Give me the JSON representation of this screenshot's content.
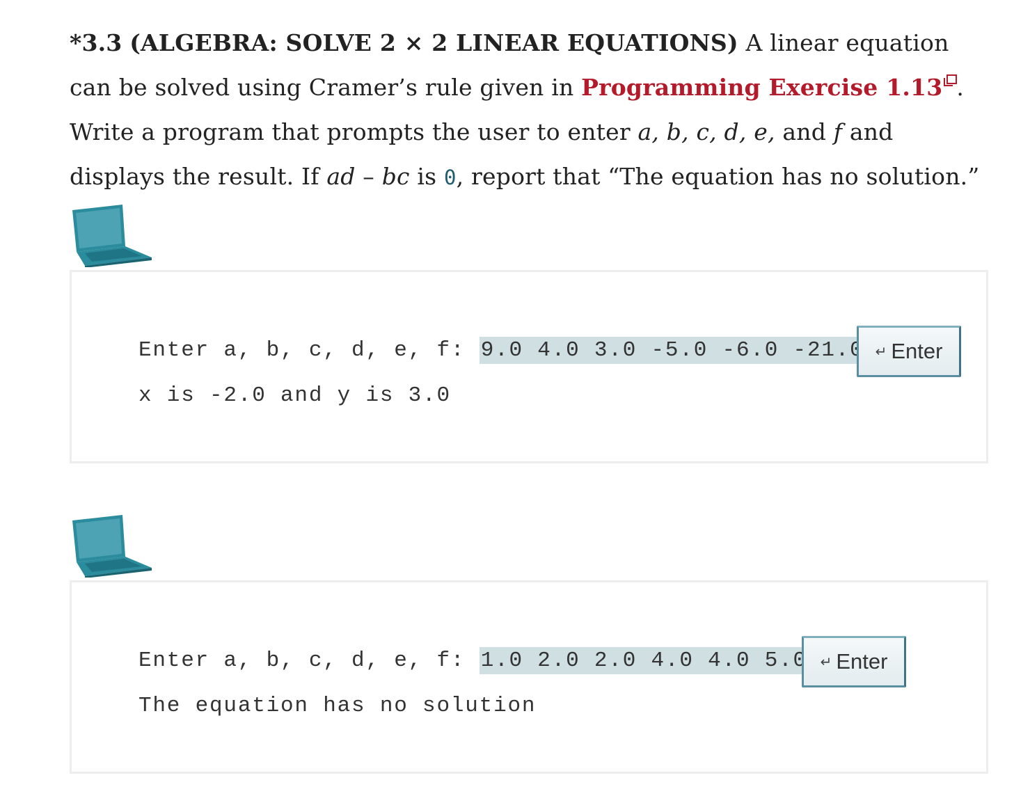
{
  "problem": {
    "number": "*3.3",
    "title": "(ALGEBRA: SOLVE 2 × 2 LINEAR EQUATIONS)",
    "text_1": " A linear equation can be solved using Cramer’s rule given in ",
    "link_label": "Programming Exercise 1.13",
    "text_2": ". Write a program that prompts the user to enter ",
    "vars": "a, b, c, d, e,",
    "text_and": " and ",
    "var_f": "f",
    "text_3": " and displays the result. If ",
    "expr_ad": "ad",
    "text_minus": " – ",
    "expr_bc": "bc",
    "text_is": " is ",
    "zero": "0",
    "text_4": ", report that “The equation has no solution.”"
  },
  "icons": {
    "external_link": "external-link-icon",
    "laptop": "laptop-icon",
    "enter": "enter-key-icon"
  },
  "colors": {
    "link": "#b31b2a",
    "input_highlight": "#cfdfe2",
    "laptop": "#2a8c9c"
  },
  "runs": [
    {
      "prompt": "Enter a, b, c, d, e, f: ",
      "input": "9.0 4.0 3.0 -5.0 -6.0 -21.0",
      "enter_label": "Enter",
      "output": "x is -2.0 and y is 3.0"
    },
    {
      "prompt": "Enter a, b, c, d, e, f: ",
      "input": "1.0 2.0 2.0 4.0 4.0 5.0",
      "enter_label": "Enter",
      "output": "The equation has no solution"
    }
  ]
}
